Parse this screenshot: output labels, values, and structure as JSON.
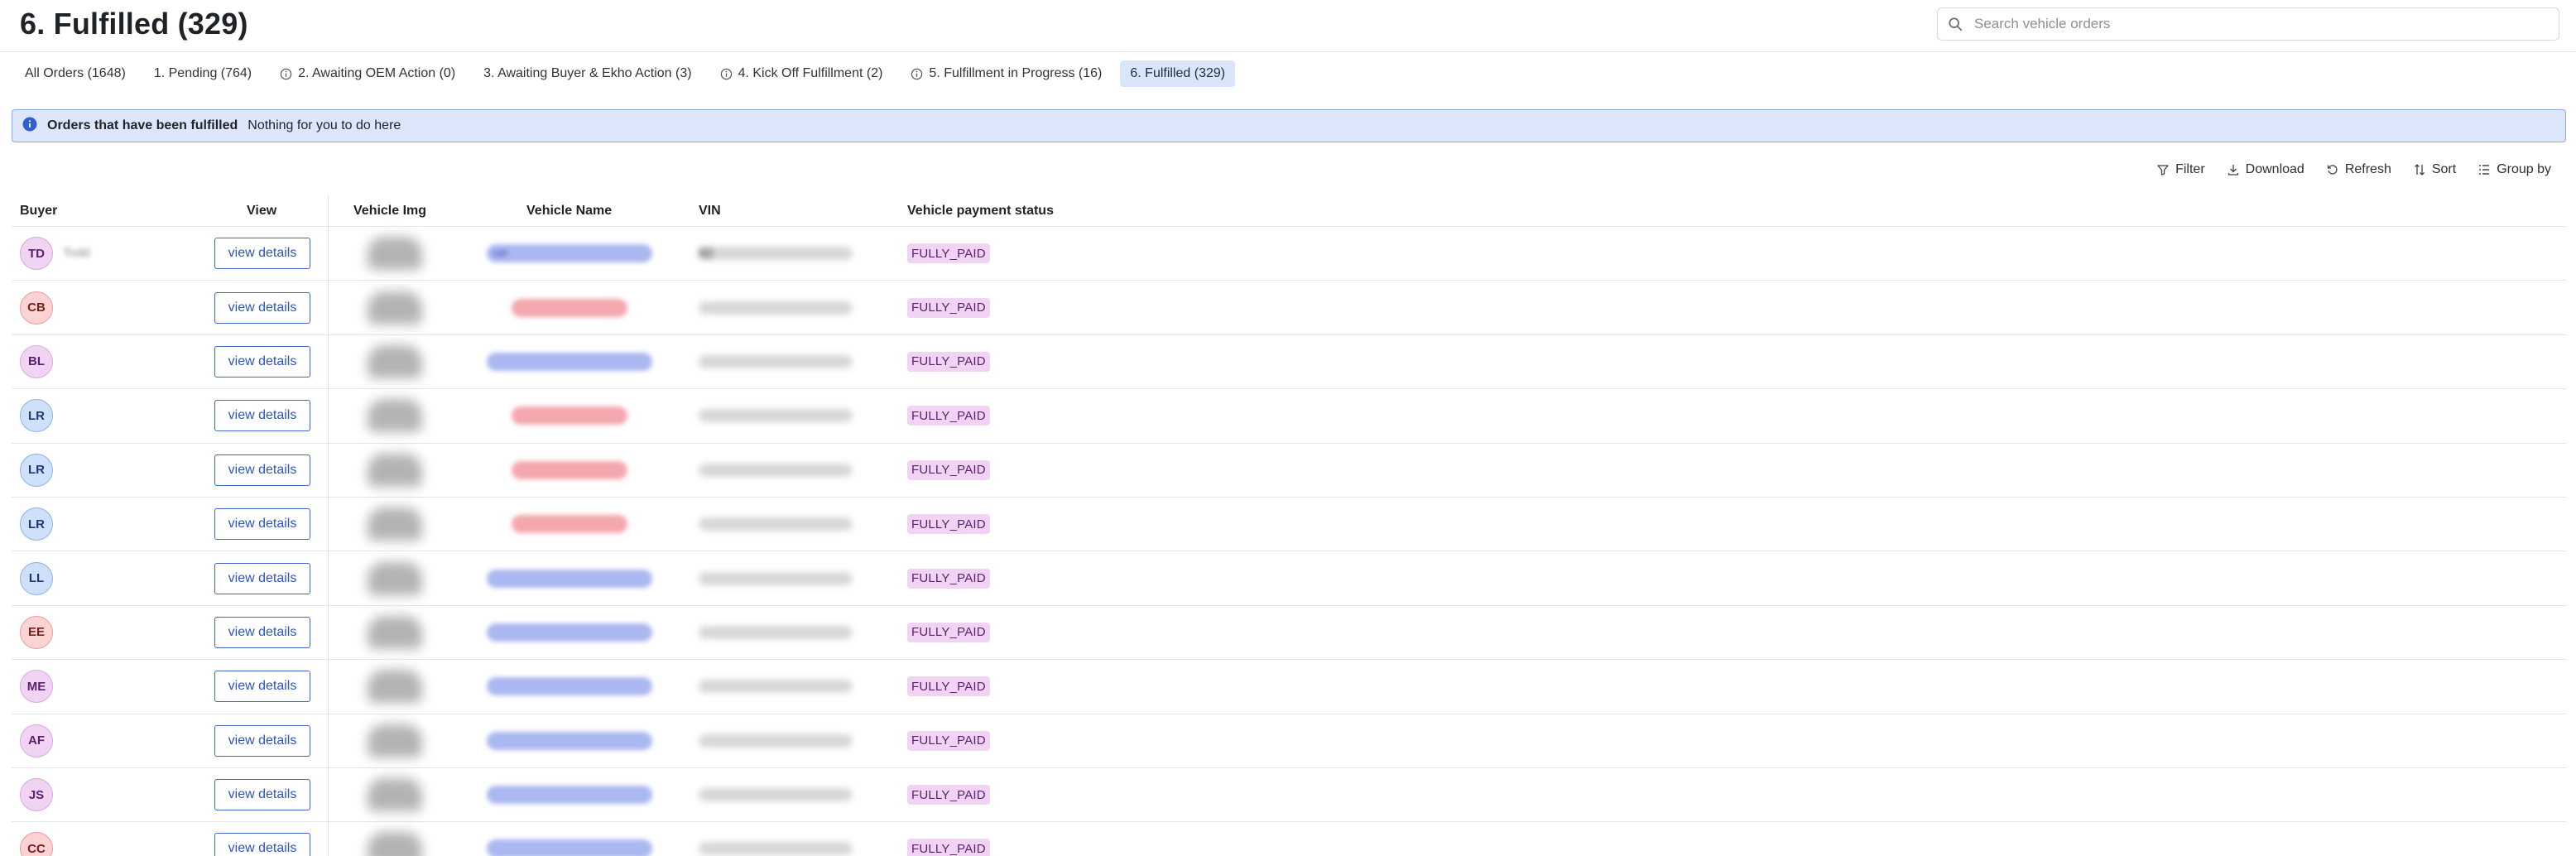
{
  "page": {
    "title": "6. Fulfilled (329)"
  },
  "search": {
    "placeholder": "Search vehicle orders"
  },
  "tabs": [
    {
      "label": "All Orders (1648)",
      "icon": "",
      "active": false
    },
    {
      "label": "1. Pending (764)",
      "icon": "",
      "active": false
    },
    {
      "label": "2. Awaiting OEM Action (0)",
      "icon": "info-circle-icon",
      "active": false
    },
    {
      "label": "3. Awaiting Buyer & Ekho Action (3)",
      "icon": "",
      "active": false
    },
    {
      "label": "4. Kick Off Fulfillment (2)",
      "icon": "info-circle-icon",
      "active": false
    },
    {
      "label": "5. Fulfillment in Progress (16)",
      "icon": "info-circle-icon",
      "active": false
    },
    {
      "label": "6. Fulfilled (329)",
      "icon": "",
      "active": true
    }
  ],
  "banner": {
    "icon": "info-filled-icon",
    "title": "Orders that have been fulfilled",
    "message": "Nothing for you to do here",
    "color": "#dde7fc"
  },
  "toolbar": {
    "filter": "Filter",
    "download": "Download",
    "refresh": "Refresh",
    "sort": "Sort",
    "group_by": "Group by"
  },
  "table": {
    "columns": {
      "buyer": "Buyer",
      "view": "View",
      "vehicle_img": "Vehicle Img",
      "vehicle_name": "Vehicle Name",
      "vin": "VIN",
      "payment_status": "Vehicle payment status"
    },
    "view_button_label": "view details",
    "rows": [
      {
        "initials": "TD",
        "avatar": "purple",
        "name_visible": "Todd",
        "vehicle_style": "blue",
        "vehicle_visible": "HP",
        "vin_visible": "82",
        "status": "FULLY_PAID"
      },
      {
        "initials": "CB",
        "avatar": "red",
        "name_visible": "",
        "vehicle_style": "red",
        "vehicle_visible": "",
        "vin_visible": "",
        "status": "FULLY_PAID"
      },
      {
        "initials": "BL",
        "avatar": "purple",
        "name_visible": "",
        "vehicle_style": "blue",
        "vehicle_visible": "",
        "vin_visible": "",
        "status": "FULLY_PAID"
      },
      {
        "initials": "LR",
        "avatar": "blue",
        "name_visible": "",
        "vehicle_style": "red",
        "vehicle_visible": "",
        "vin_visible": "",
        "status": "FULLY_PAID"
      },
      {
        "initials": "LR",
        "avatar": "blue",
        "name_visible": "",
        "vehicle_style": "red",
        "vehicle_visible": "",
        "vin_visible": "",
        "status": "FULLY_PAID"
      },
      {
        "initials": "LR",
        "avatar": "blue",
        "name_visible": "",
        "vehicle_style": "red",
        "vehicle_visible": "",
        "vin_visible": "",
        "status": "FULLY_PAID"
      },
      {
        "initials": "LL",
        "avatar": "blue",
        "name_visible": "",
        "vehicle_style": "blue",
        "vehicle_visible": "",
        "vin_visible": "",
        "status": "FULLY_PAID"
      },
      {
        "initials": "EE",
        "avatar": "red",
        "name_visible": "",
        "vehicle_style": "blue",
        "vehicle_visible": "",
        "vin_visible": "",
        "status": "FULLY_PAID"
      },
      {
        "initials": "ME",
        "avatar": "purple",
        "name_visible": "",
        "vehicle_style": "blue",
        "vehicle_visible": "",
        "vin_visible": "",
        "status": "FULLY_PAID"
      },
      {
        "initials": "AF",
        "avatar": "purple",
        "name_visible": "",
        "vehicle_style": "blue",
        "vehicle_visible": "",
        "vin_visible": "",
        "status": "FULLY_PAID"
      },
      {
        "initials": "JS",
        "avatar": "purple",
        "name_visible": "",
        "vehicle_style": "blue",
        "vehicle_visible": "",
        "vin_visible": "",
        "status": "FULLY_PAID"
      },
      {
        "initials": "CC",
        "avatar": "red",
        "name_visible": "",
        "vehicle_style": "blue",
        "vehicle_visible": "",
        "vin_visible": "",
        "status": "FULLY_PAID"
      }
    ]
  },
  "colors": {
    "accent": "#3e68c9",
    "active_tab": "#d9e5fa",
    "status_badge": "#f1d3f3"
  }
}
